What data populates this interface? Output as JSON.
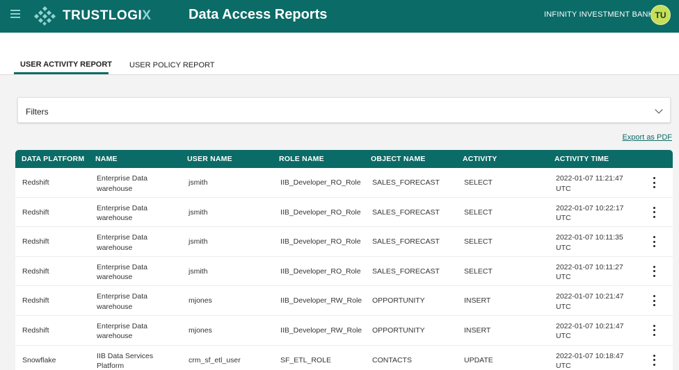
{
  "header": {
    "brand_name": "TRUSTLOGI",
    "brand_suffix": "X",
    "page_title": "Data Access Reports",
    "org_name": "INFINITY INVESTMENT BANK",
    "avatar_initials": "TU",
    "colors": {
      "primary": "#0b6b67",
      "avatar": "#c6de5a"
    }
  },
  "tabs": [
    {
      "label": "USER ACTIVITY REPORT",
      "active": true
    },
    {
      "label": "USER POLICY REPORT",
      "active": false
    }
  ],
  "filters": {
    "label": "Filters"
  },
  "export": {
    "label": "Export as PDF"
  },
  "table": {
    "columns": [
      "DATA PLATFORM",
      "NAME",
      "USER NAME",
      "ROLE NAME",
      "OBJECT NAME",
      "ACTIVITY",
      "ACTIVITY TIME"
    ],
    "rows": [
      {
        "platform": "Redshift",
        "name": [
          "Enterprise Data",
          "warehouse"
        ],
        "user": "jsmith",
        "role": "IIB_Developer_RO_Role",
        "object": "SALES_FORECAST",
        "activity": "SELECT",
        "time": [
          "2022-01-07 11:21:47",
          "UTC"
        ]
      },
      {
        "platform": "Redshift",
        "name": [
          "Enterprise Data",
          "warehouse"
        ],
        "user": "jsmith",
        "role": "IIB_Developer_RO_Role",
        "object": "SALES_FORECAST",
        "activity": "SELECT",
        "time": [
          "2022-01-07 10:22:17",
          "UTC"
        ]
      },
      {
        "platform": "Redshift",
        "name": [
          "Enterprise Data",
          "warehouse"
        ],
        "user": "jsmith",
        "role": "IIB_Developer_RO_Role",
        "object": "SALES_FORECAST",
        "activity": "SELECT",
        "time": [
          "2022-01-07 10:11:35",
          "UTC"
        ]
      },
      {
        "platform": "Redshift",
        "name": [
          "Enterprise Data",
          "warehouse"
        ],
        "user": "jsmith",
        "role": "IIB_Developer_RO_Role",
        "object": "SALES_FORECAST",
        "activity": "SELECT",
        "time": [
          "2022-01-07 10:11:27",
          "UTC"
        ]
      },
      {
        "platform": "Redshift",
        "name": [
          "Enterprise Data",
          "warehouse"
        ],
        "user": "mjones",
        "role": "IIB_Developer_RW_Role",
        "object": "OPPORTUNITY",
        "activity": "INSERT",
        "time": [
          "2022-01-07 10:21:47",
          "UTC"
        ]
      },
      {
        "platform": "Redshift",
        "name": [
          "Enterprise Data",
          "warehouse"
        ],
        "user": "mjones",
        "role": "IIB_Developer_RW_Role",
        "object": "OPPORTUNITY",
        "activity": "INSERT",
        "time": [
          "2022-01-07 10:21:47",
          "UTC"
        ]
      },
      {
        "platform": "Snowflake",
        "name": [
          "IIB Data Services",
          "Platform"
        ],
        "user": "crm_sf_etl_user",
        "role": "SF_ETL_ROLE",
        "object": "CONTACTS",
        "activity": "UPDATE",
        "time": [
          "2022-01-07 10:18:47",
          "UTC"
        ]
      }
    ]
  }
}
